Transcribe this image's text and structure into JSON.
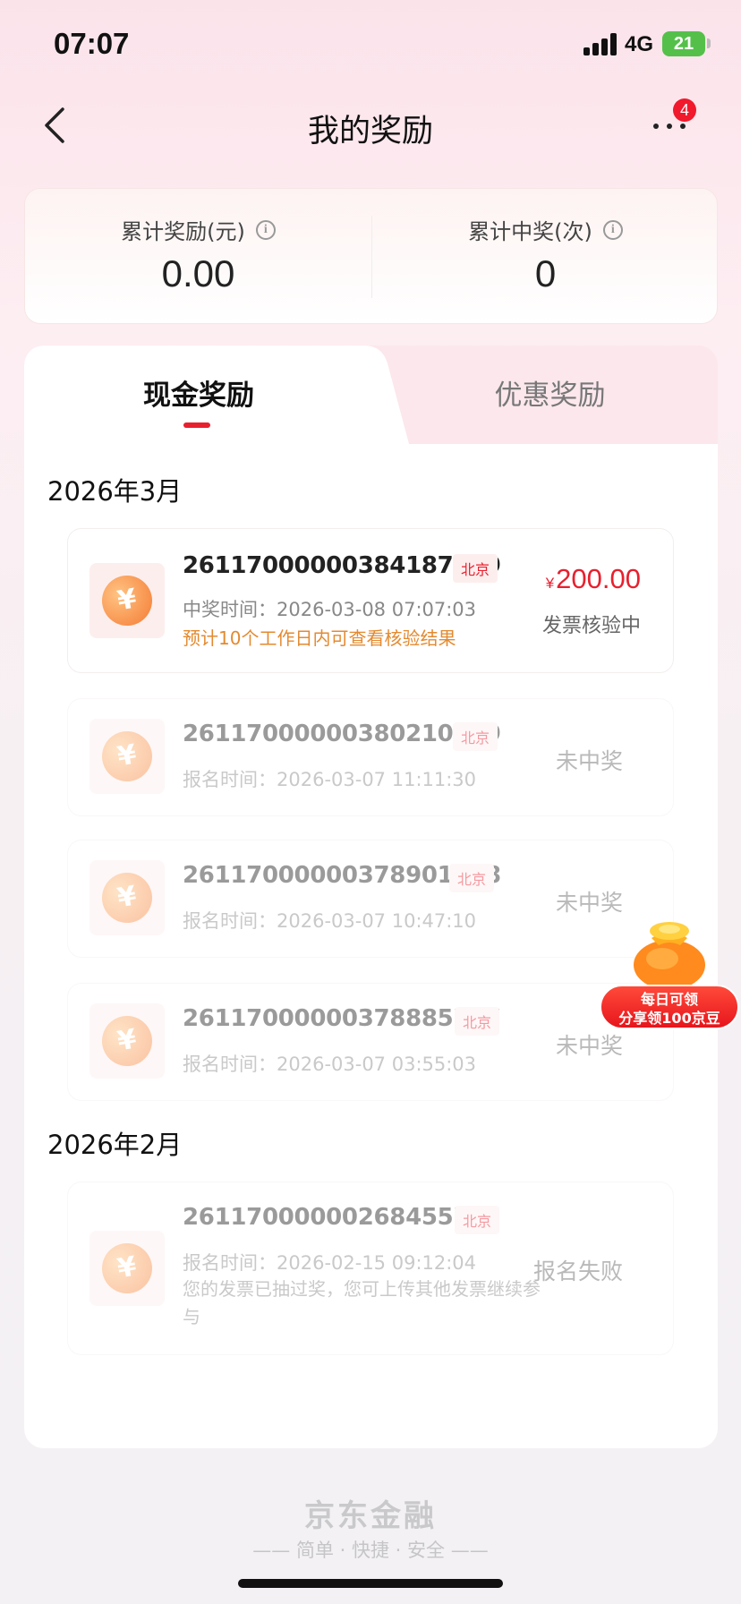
{
  "status_bar": {
    "time": "07:07",
    "network": "4G",
    "battery": "21"
  },
  "nav": {
    "title": "我的奖励",
    "badge": "4"
  },
  "summary": {
    "total_reward_label": "累计奖励(元)",
    "total_reward_value": "0.00",
    "total_wins_label": "累计中奖(次)",
    "total_wins_value": "0"
  },
  "tabs": {
    "cash": "现金奖励",
    "coupon": "优惠奖励"
  },
  "months": [
    {
      "label": "2026年3月",
      "records": [
        {
          "id": "26117000000384187609",
          "city": "北京",
          "time_label": "中奖时间：",
          "time": "2026-03-08 07:07:03",
          "note": "预计10个工作日内可查看核验结果",
          "currency": "¥",
          "amount": "200.00",
          "status": "发票核验中"
        },
        {
          "id": "26117000000380210789",
          "city": "北京",
          "time_label": "报名时间：",
          "time": "2026-03-07 11:11:30",
          "status": "未中奖"
        },
        {
          "id": "26117000000378901148",
          "city": "北京",
          "time_label": "报名时间：",
          "time": "2026-03-07 10:47:10",
          "status": "未中奖"
        },
        {
          "id": "26117000000378885747",
          "city": "北京",
          "time_label": "报名时间：",
          "time": "2026-03-07 03:55:03",
          "status": "未中奖"
        }
      ]
    },
    {
      "label": "2026年2月",
      "records": [
        {
          "id": "26117000000268455703",
          "city": "北京",
          "time_label": "报名时间：",
          "time": "2026-02-15 09:12:04",
          "note": "您的发票已抽过奖，您可上传其他发票继续参与",
          "status": "报名失败"
        }
      ]
    }
  ],
  "promo": {
    "line1": "每日可领",
    "line2": "分享领100京豆"
  },
  "footer": {
    "brand": "京东金融",
    "slogan": "—— 简单 · 快捷 · 安全 ——"
  },
  "colors": {
    "accent_red": "#e8202e",
    "note_orange": "#e38a30"
  }
}
